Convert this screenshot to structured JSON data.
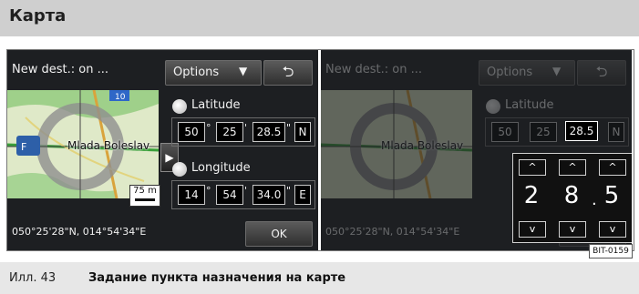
{
  "header": {
    "title": "Карта"
  },
  "screen": {
    "title": "New dest.: on ...",
    "options_label": "Options",
    "back_icon": "return-arrow-icon",
    "map": {
      "town_label": "Mlada Boleslav",
      "road_number": "10",
      "scale": "75 m"
    },
    "latitude_label": "Latitude",
    "longitude_label": "Longitude",
    "latitude": {
      "deg": "50",
      "min": "25",
      "sec": "28.5",
      "hem": "N"
    },
    "longitude": {
      "deg": "14",
      "min": "54",
      "sec": "34.0",
      "hem": "E"
    },
    "coords_text": "050°25'28\"N, 014°54'34\"E",
    "ok_label": "OK",
    "units": {
      "deg": "°",
      "min": "'",
      "sec": "\""
    }
  },
  "spinner": {
    "digits": [
      "2",
      "8",
      "5"
    ],
    "separator": ".",
    "up_icon": "^",
    "down_icon": "v"
  },
  "figure_id": "BIT-0159",
  "caption": {
    "number": "Илл. 43",
    "text": "Задание пункта назначения на карте"
  },
  "colors": {
    "header_bg": "#cfcfcf",
    "screen_bg": "#1d1f22",
    "caption_bg": "#e7e7e7"
  }
}
